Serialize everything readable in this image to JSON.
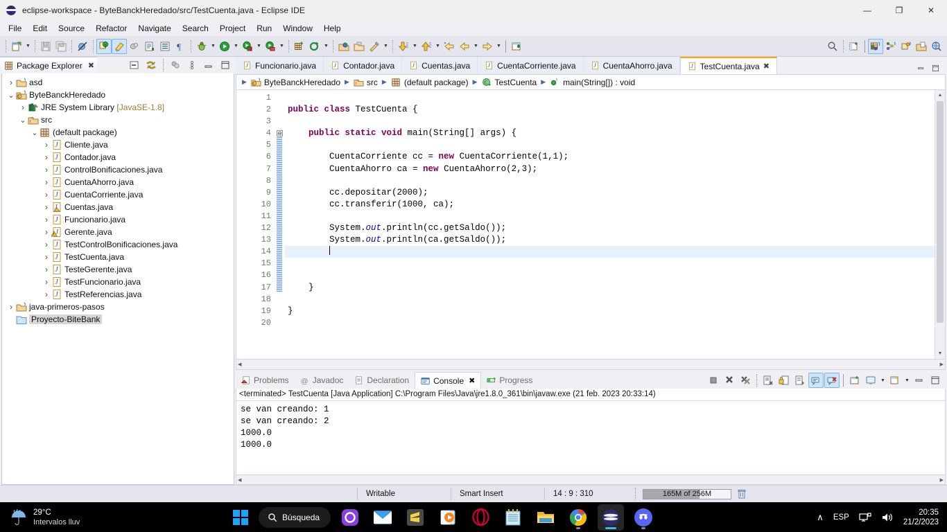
{
  "window": {
    "title": "eclipse-workspace - ByteBanckHeredado/src/TestCuenta.java - Eclipse IDE",
    "minimize": "—",
    "maximize": "❐",
    "close": "✕"
  },
  "menubar": {
    "items": [
      "File",
      "Edit",
      "Source",
      "Refactor",
      "Navigate",
      "Search",
      "Project",
      "Run",
      "Window",
      "Help"
    ]
  },
  "toolbar": {
    "icons": [
      "new-file-icon",
      "save-icon",
      "save-all-icon",
      "no-debug-icon",
      "skip-breakpoints-icon",
      "toggle-mark-occurrences-icon",
      "link-icon",
      "external-tools-icon",
      "open-type-icon",
      "show-whitespace-icon",
      "debug-icon",
      "run-icon",
      "coverage-icon",
      "profile-icon",
      "new-java-project-icon",
      "new-annotation-icon",
      "open-folder-icon",
      "open-resource-icon",
      "rename-icon",
      "previous-annotation-icon",
      "next-annotation-icon",
      "back-icon",
      "forward-icon",
      "new-window-icon"
    ],
    "right_icons": [
      "search-icon",
      "open-perspective-icon",
      "java-perspective-icon",
      "java-browsing-icon",
      "debug-perspective-icon",
      "git-perspective-icon",
      "java-ee-perspective-icon"
    ]
  },
  "package_explorer": {
    "tab_label": "Package Explorer",
    "close_glyph": "✖",
    "tools": [
      "collapse-all-icon",
      "link-with-editor-icon",
      "view-menu-icon",
      "minimize-icon",
      "maximize-icon"
    ],
    "tree": [
      {
        "indent": 0,
        "arrow": "right",
        "icon": "closed-project-icon",
        "label": "asd"
      },
      {
        "indent": 0,
        "arrow": "down",
        "icon": "java-project-icon",
        "label": "ByteBanckHeredado"
      },
      {
        "indent": 1,
        "arrow": "right",
        "icon": "jre-library-icon",
        "label": "JRE System Library",
        "dim": " [JavaSE-1.8]"
      },
      {
        "indent": 1,
        "arrow": "down",
        "icon": "source-folder-icon",
        "label": "src"
      },
      {
        "indent": 2,
        "arrow": "down",
        "icon": "package-icon",
        "label": "(default package)"
      },
      {
        "indent": 3,
        "arrow": "right",
        "icon": "java-file-icon",
        "label": "Cliente.java"
      },
      {
        "indent": 3,
        "arrow": "right",
        "icon": "java-file-icon",
        "label": "Contador.java"
      },
      {
        "indent": 3,
        "arrow": "right",
        "icon": "java-file-icon",
        "label": "ControlBonificaciones.java"
      },
      {
        "indent": 3,
        "arrow": "right",
        "icon": "java-file-icon",
        "label": "CuentaAhorro.java"
      },
      {
        "indent": 3,
        "arrow": "right",
        "icon": "java-file-icon",
        "label": "CuentaCorriente.java"
      },
      {
        "indent": 3,
        "arrow": "right",
        "icon": "java-abstract-file-icon",
        "label": "Cuentas.java"
      },
      {
        "indent": 3,
        "arrow": "right",
        "icon": "java-file-icon",
        "label": "Funcionario.java"
      },
      {
        "indent": 3,
        "arrow": "right",
        "icon": "java-warning-file-icon",
        "label": "Gerente.java"
      },
      {
        "indent": 3,
        "arrow": "right",
        "icon": "java-file-icon",
        "label": "TestControlBonificaciones.java"
      },
      {
        "indent": 3,
        "arrow": "right",
        "icon": "java-file-icon",
        "label": "TestCuenta.java"
      },
      {
        "indent": 3,
        "arrow": "right",
        "icon": "java-file-icon",
        "label": "TesteGerente.java"
      },
      {
        "indent": 3,
        "arrow": "right",
        "icon": "java-file-icon",
        "label": "TestFuncionario.java"
      },
      {
        "indent": 3,
        "arrow": "right",
        "icon": "java-file-icon",
        "label": "TestReferencias.java"
      },
      {
        "indent": 0,
        "arrow": "right",
        "icon": "closed-project-icon",
        "label": "java-primeros-pasos"
      },
      {
        "indent": 0,
        "arrow": "none",
        "icon": "folder-icon",
        "label": "Proyecto-BiteBank",
        "selected": true
      }
    ]
  },
  "editor": {
    "tabs": [
      {
        "label": "Funcionario.java",
        "active": false
      },
      {
        "label": "Contador.java",
        "active": false
      },
      {
        "label": "Cuentas.java",
        "active": false
      },
      {
        "label": "CuentaCorriente.java",
        "active": false
      },
      {
        "label": "CuentaAhorro.java",
        "active": false
      },
      {
        "label": "TestCuenta.java",
        "active": true
      }
    ],
    "tab_close_glyph": "✖",
    "breadcrumb": [
      {
        "icon": "java-project-icon",
        "label": "ByteBanckHeredado"
      },
      {
        "icon": "source-folder-icon",
        "label": "src"
      },
      {
        "icon": "package-icon",
        "label": "(default package)"
      },
      {
        "icon": "class-icon",
        "label": "TestCuenta"
      },
      {
        "icon": "method-static-icon",
        "label": "main(String[]) : void"
      }
    ],
    "breadcrumb_sep": "▶",
    "line_numbers": [
      "1",
      "2",
      "3",
      "4",
      "5",
      "6",
      "7",
      "8",
      "9",
      "10",
      "11",
      "12",
      "13",
      "14",
      "15",
      "16",
      "17",
      "18",
      "19",
      "20"
    ],
    "highlight_line": 14,
    "fold_line": 4,
    "fold_glyph": "⊖",
    "lines": [
      {
        "n": 1,
        "tokens": []
      },
      {
        "n": 2,
        "tokens": [
          {
            "t": "kw",
            "s": "public class "
          },
          {
            "t": "p",
            "s": "TestCuenta {"
          }
        ]
      },
      {
        "n": 3,
        "tokens": []
      },
      {
        "n": 4,
        "tokens": [
          {
            "t": "p",
            "s": "    "
          },
          {
            "t": "kw",
            "s": "public static void "
          },
          {
            "t": "p",
            "s": "main(String[] args) {"
          }
        ]
      },
      {
        "n": 5,
        "tokens": []
      },
      {
        "n": 6,
        "tokens": [
          {
            "t": "p",
            "s": "        CuentaCorriente cc = "
          },
          {
            "t": "kw",
            "s": "new "
          },
          {
            "t": "p",
            "s": "CuentaCorriente(1,1);"
          }
        ]
      },
      {
        "n": 7,
        "tokens": [
          {
            "t": "p",
            "s": "        CuentaAhorro ca = "
          },
          {
            "t": "kw",
            "s": "new "
          },
          {
            "t": "p",
            "s": "CuentaAhorro(2,3);"
          }
        ]
      },
      {
        "n": 8,
        "tokens": []
      },
      {
        "n": 9,
        "tokens": [
          {
            "t": "p",
            "s": "        cc.depositar(2000);"
          }
        ]
      },
      {
        "n": 10,
        "tokens": [
          {
            "t": "p",
            "s": "        cc.transferir(1000, ca);"
          }
        ]
      },
      {
        "n": 11,
        "tokens": []
      },
      {
        "n": 12,
        "tokens": [
          {
            "t": "p",
            "s": "        System."
          },
          {
            "t": "fld",
            "s": "out"
          },
          {
            "t": "p",
            "s": ".println(cc.getSaldo());"
          }
        ]
      },
      {
        "n": 13,
        "tokens": [
          {
            "t": "p",
            "s": "        System."
          },
          {
            "t": "fld",
            "s": "out"
          },
          {
            "t": "p",
            "s": ".println(ca.getSaldo());"
          }
        ]
      },
      {
        "n": 14,
        "tokens": [
          {
            "t": "p",
            "s": "        "
          },
          {
            "t": "caret",
            "s": ""
          }
        ]
      },
      {
        "n": 15,
        "tokens": []
      },
      {
        "n": 16,
        "tokens": []
      },
      {
        "n": 17,
        "tokens": [
          {
            "t": "p",
            "s": "    }"
          }
        ]
      },
      {
        "n": 18,
        "tokens": []
      },
      {
        "n": 19,
        "tokens": [
          {
            "t": "p",
            "s": "}"
          }
        ]
      },
      {
        "n": 20,
        "tokens": []
      }
    ]
  },
  "console": {
    "tabs": [
      {
        "label": "Problems",
        "icon": "problems-icon",
        "active": false
      },
      {
        "label": "Javadoc",
        "icon": "javadoc-icon",
        "active": false
      },
      {
        "label": "Declaration",
        "icon": "declaration-icon",
        "active": false
      },
      {
        "label": "Console",
        "icon": "console-icon",
        "active": true
      },
      {
        "label": "Progress",
        "icon": "progress-icon",
        "active": false
      }
    ],
    "close_glyph": "✖",
    "tools": [
      "terminate-icon",
      "remove-launch-icon",
      "remove-all-launches-icon",
      "clear-console-icon",
      "scroll-lock-icon",
      "word-wrap-icon",
      "pin-console-icon",
      "display-selected-console-icon",
      "open-console-icon",
      "minimize-icon",
      "maximize-icon"
    ],
    "header": "<terminated> TestCuenta [Java Application] C:\\Program Files\\Java\\jre1.8.0_361\\bin\\javaw.exe (21 feb. 2023 20:33:14)",
    "output": "se van creando: 1\nse van creando: 2\n1000.0\n1000.0"
  },
  "statusbar": {
    "writable": "Writable",
    "insert_mode": "Smart Insert",
    "position": "14 : 9 : 310",
    "heap": "165M of 256M",
    "heap_percent": 64,
    "trash_icon": "trash-icon"
  },
  "taskbar": {
    "weather": {
      "temp": "29°C",
      "desc": "Intervalos lluv",
      "icon": "rain-umbrella-icon"
    },
    "start": "start-icon",
    "search": {
      "label": "Búsqueda",
      "icon": "search-icon"
    },
    "apps": [
      {
        "name": "purple-circle-app-icon",
        "running": false
      },
      {
        "name": "mail-icon",
        "running": false
      },
      {
        "name": "sublime-text-icon",
        "running": false
      },
      {
        "name": "media-player-icon",
        "running": false
      },
      {
        "name": "opera-icon",
        "running": false
      },
      {
        "name": "notepad-icon",
        "running": false
      },
      {
        "name": "file-explorer-icon",
        "running": false
      },
      {
        "name": "chrome-icon",
        "running": true
      },
      {
        "name": "eclipse-icon",
        "running": true,
        "active": true
      },
      {
        "name": "discord-icon",
        "running": true
      }
    ],
    "tray": {
      "overflow": "∧",
      "language": "ESP",
      "network_icon": "network-icon",
      "volume_icon": "volume-icon",
      "time": "20:35",
      "date": "21/2/2023"
    }
  }
}
